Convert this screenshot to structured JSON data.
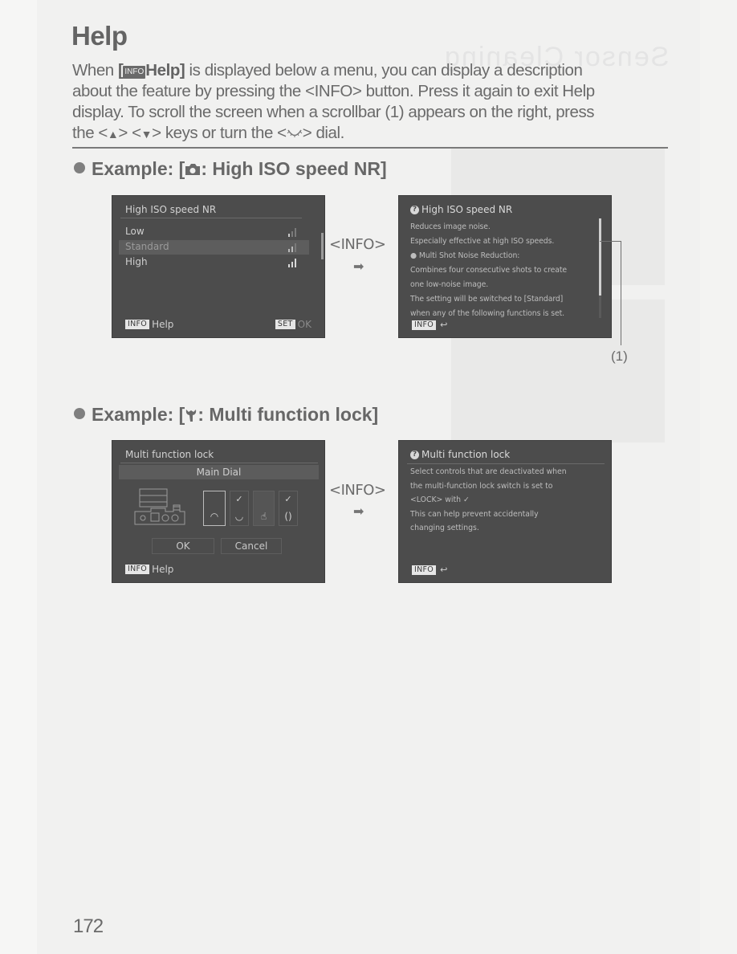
{
  "page": {
    "title": "Help",
    "intro": {
      "pre": "When ",
      "bracket_open": "[",
      "chip": "INFO",
      "bold_label": "Help]",
      "line1_rest": " is displayed below a menu, you can display a description",
      "line2": "about the feature by pressing the <INFO> button. Press it again to exit Help",
      "line3": "display. To scroll the screen when a scrollbar (1) appears on the right, press",
      "line4_pre": "the <",
      "up_key": "▲",
      "line4_mid": "> <",
      "down_key": "▼",
      "line4_mid2": "> keys or turn the <",
      "dial": "dial-icon",
      "line4_end": "> dial."
    },
    "page_number": "172",
    "bleed_through_text": "Sensor Cleaning"
  },
  "example1": {
    "heading_pre": "Example: [",
    "icon": "camera-icon",
    "heading_post": ": High ISO speed NR]",
    "menu_screen": {
      "title": "High ISO speed NR",
      "options": [
        {
          "label": "Low",
          "level": 1,
          "selected": false
        },
        {
          "label": "Standard",
          "level": 2,
          "selected": true
        },
        {
          "label": "High",
          "level": 3,
          "selected": false
        }
      ],
      "footer_left_chip": "INFO",
      "footer_left_label": "Help",
      "footer_right_chip": "SET",
      "footer_right_label": "OK"
    },
    "transition": {
      "label": "<INFO>",
      "arrow": "➡"
    },
    "help_screen": {
      "title": "High ISO speed NR",
      "lines": [
        "Reduces image noise.",
        "Especially effective at high ISO speeds.",
        "● Multi Shot Noise Reduction:",
        "Combines four consecutive shots to create",
        "one low-noise image.",
        "The setting will be switched to [Standard]",
        "when any of the following functions is set."
      ],
      "footer_chip": "INFO",
      "footer_icon": "↩"
    },
    "callout_label": "(1)"
  },
  "example2": {
    "heading_pre": "Example: [",
    "icon": "wrench-icon",
    "heading_post": ": Multi function lock]",
    "menu_screen": {
      "title": "Multi function lock",
      "selected_control": "Main Dial",
      "controls": [
        {
          "name": "main-dial",
          "checked": false,
          "glyph": "◠",
          "selected": true
        },
        {
          "name": "quick-control-dial",
          "checked": true,
          "glyph": "◡",
          "selected": false
        },
        {
          "name": "touch-control",
          "checked": false,
          "glyph": "☝",
          "selected": false
        },
        {
          "name": "multi-controller",
          "checked": true,
          "glyph": "()",
          "selected": false
        }
      ],
      "check_mark": "✓",
      "ok_label": "OK",
      "cancel_label": "Cancel",
      "footer_left_chip": "INFO",
      "footer_left_label": "Help"
    },
    "transition": {
      "label": "<INFO>",
      "arrow": "➡"
    },
    "help_screen": {
      "title": "Multi function lock",
      "lines": [
        "Select controls that are deactivated when",
        "the multi-function lock switch is set to",
        "<LOCK> with ✓",
        "This can help prevent accidentally",
        "changing settings."
      ],
      "footer_chip": "INFO",
      "footer_icon": "↩"
    }
  }
}
